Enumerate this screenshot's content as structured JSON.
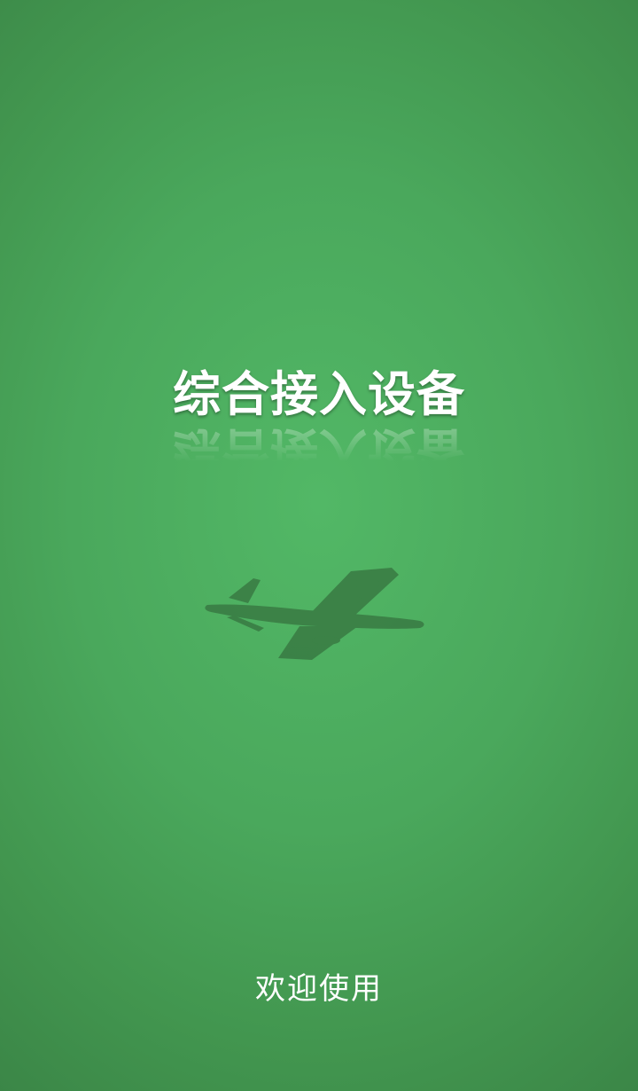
{
  "splash": {
    "title": "综合接入设备",
    "welcome": "欢迎使用"
  },
  "icons": {
    "background_graphic": "airplane-silhouette-icon"
  },
  "colors": {
    "background_center": "#52b866",
    "background_edge": "#3b8647",
    "text": "#ffffff",
    "plane_shadow": "#3a7d45"
  }
}
